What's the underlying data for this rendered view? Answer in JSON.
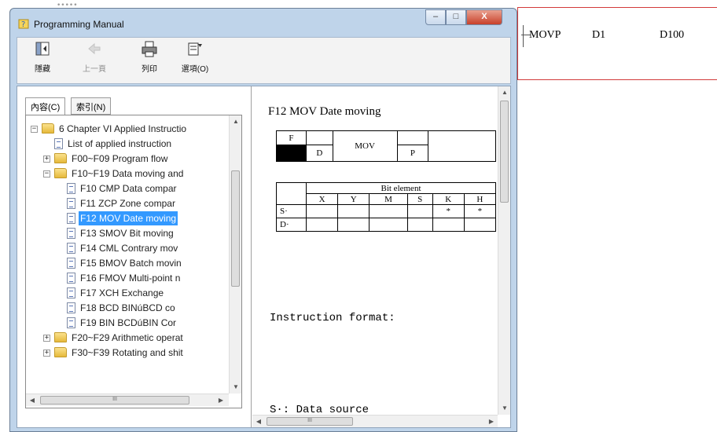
{
  "window": {
    "title": "Programming Manual",
    "buttons": {
      "minimize": "–",
      "maximize": "□",
      "close": "X"
    },
    "behind_title": "•••••"
  },
  "toolbar": {
    "hide": "隱藏",
    "back": "上一頁",
    "print": "列印",
    "options": "選項(O)"
  },
  "tabs": {
    "contents": "內容(C)",
    "index": "索引(N)"
  },
  "tree": {
    "items": [
      {
        "label": "6 Chapter VI Applied Instructio",
        "type": "folder",
        "expander": "−"
      },
      {
        "label": "List of applied instruction",
        "type": "page"
      },
      {
        "label": "F00~F09 Program flow",
        "type": "folder",
        "expander": "+"
      },
      {
        "label": "F10~F19 Data moving and",
        "type": "folder",
        "expander": "−"
      },
      {
        "label": "F10 CMP Data compar",
        "type": "page"
      },
      {
        "label": "F11 ZCP Zone compar",
        "type": "page"
      },
      {
        "label": "F12 MOV Date moving",
        "type": "page",
        "selected": true
      },
      {
        "label": "F13 SMOV Bit moving",
        "type": "page"
      },
      {
        "label": "F14 CML Contrary mov",
        "type": "page"
      },
      {
        "label": "F15 BMOV Batch movin",
        "type": "page"
      },
      {
        "label": "F16 FMOV Multi-point n",
        "type": "page"
      },
      {
        "label": "F17 XCH Exchange",
        "type": "page"
      },
      {
        "label": "F18 BCD BINúBCD co",
        "type": "page"
      },
      {
        "label": "F19 BIN BCDúBIN Cor",
        "type": "page"
      },
      {
        "label": "F20~F29 Arithmetic operat",
        "type": "folder",
        "expander": "+"
      },
      {
        "label": "F30~F39 Rotating and shit",
        "type": "folder",
        "expander": "+"
      }
    ],
    "hscroll_grip": "III"
  },
  "content": {
    "heading": "F12 MOV Date moving",
    "table1": {
      "f": "F",
      "d": "D",
      "mov": "MOV",
      "p": "P"
    },
    "table2": {
      "title": "Bit element",
      "columns": [
        "X",
        "Y",
        "M",
        "S",
        "K",
        "H"
      ],
      "rows": [
        {
          "label": "S·",
          "cells": [
            "",
            "",
            "",
            "",
            "*",
            "*"
          ]
        },
        {
          "label": "D·",
          "cells": [
            "",
            "",
            "",
            "",
            "",
            ""
          ]
        }
      ]
    },
    "instruction_format": "Instruction format:",
    "source": "S·: Data source",
    "hscroll_grip": "III"
  },
  "ladder": {
    "op": "MOVP",
    "src": "D1",
    "dst": "D100"
  }
}
